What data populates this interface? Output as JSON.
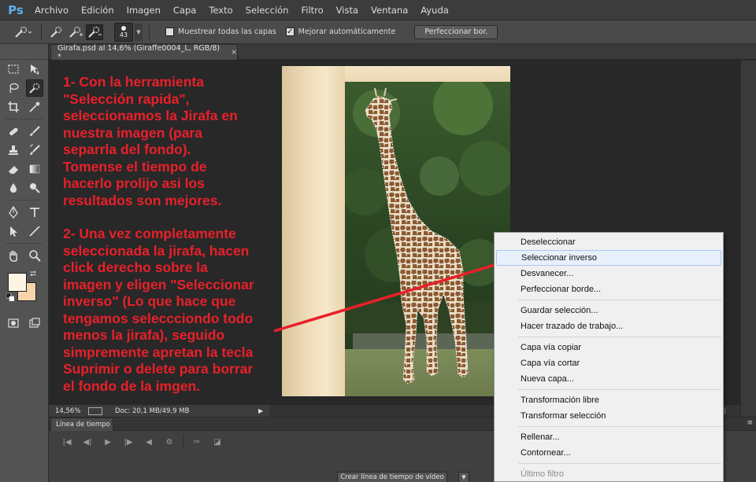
{
  "app": {
    "logo": "Ps"
  },
  "menu": [
    "Archivo",
    "Edición",
    "Imagen",
    "Capa",
    "Texto",
    "Selección",
    "Filtro",
    "Vista",
    "Ventana",
    "Ayuda"
  ],
  "options": {
    "brush_size": "43",
    "sample_all_layers_label": "Muestrear todas las capas",
    "sample_all_layers_checked": false,
    "auto_enhance_label": "Mejorar automáticamente",
    "auto_enhance_checked": true,
    "refine_button": "Perfeccionar bor."
  },
  "document": {
    "tab_title": "Girafa.psd al 14,6% (Giraffe0004_L, RGB/8) *",
    "close": "×"
  },
  "instructions": {
    "step1": "1- Con la herramienta\n\"Selección rapida\",\nseleccionamos la Jirafa en\nnuestra imagen (para\nseparrla del fondo).\nTomense el tiempo de\nhacerlo prolijo asi los\nresultados son mejores.",
    "step2": "2- Una vez completamente\nseleccionada la jirafa, hacen\nclick derecho sobre la\nimagen y eligen \"Seleccionar\ninverso\" (Lo que hace que\ntengamos seleccciondo todo\nmenos la jirafa), seguido\nsimpremente apretan la tecla\nSuprimir o delete para borrar\nel fondo de la imgen."
  },
  "status": {
    "zoom": "14,56%",
    "doc_info": "Doc: 20,1 MB/49,9 MB"
  },
  "timeline": {
    "tab_label": "Línea de tiempo",
    "create_button": "Crear línea de tiempo de vídeo"
  },
  "context_menu": {
    "items": [
      {
        "label": "Deseleccionar"
      },
      {
        "label": "Seleccionar inverso",
        "highlighted": true
      },
      {
        "label": "Desvanecer..."
      },
      {
        "label": "Perfeccionar borde..."
      },
      {
        "label": "Guardar selección..."
      },
      {
        "label": "Hacer trazado de trabajo..."
      },
      {
        "label": "Capa vía copiar"
      },
      {
        "label": "Capa vía cortar"
      },
      {
        "label": "Nueva capa..."
      },
      {
        "label": "Transformación libre"
      },
      {
        "label": "Transformar selección"
      },
      {
        "label": "Rellenar..."
      },
      {
        "label": "Contornear..."
      },
      {
        "label": "Último filtro",
        "disabled": true
      }
    ]
  },
  "colors": {
    "foreground": "#fef4e4",
    "background": "#f6d5aa",
    "annotation": "#e8202a"
  }
}
